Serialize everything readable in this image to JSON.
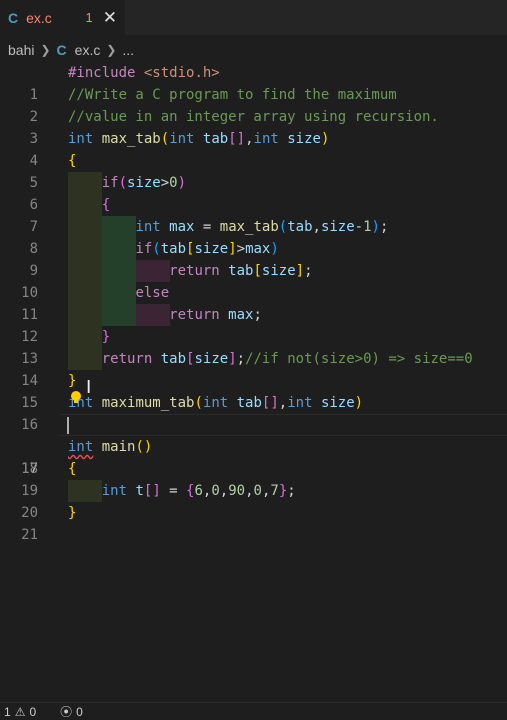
{
  "tab": {
    "icon": "C",
    "name": "ex.c",
    "problem_count": "1",
    "close_icon": "close-icon"
  },
  "breadcrumb": {
    "folder": "bahi",
    "icon": "C",
    "file": "ex.c",
    "more": "..."
  },
  "code": {
    "l1_include": "#include",
    "l1_header": "<stdio.h>",
    "l2": "//Write a C program to find the maximum",
    "l3": "//value in an integer array using recursion.",
    "l4_int": "int",
    "l4_fn": "max_tab",
    "l4_int2": "int",
    "l4_tab": "tab",
    "l4_int3": "int",
    "l4_size": "size",
    "l6_if": "if",
    "l6_size": "size",
    "l6_zero": "0",
    "l8_int": "int",
    "l8_max": "max",
    "l8_fn": "max_tab",
    "l8_tab": "tab",
    "l8_size": "size",
    "l8_one": "1",
    "l9_if": "if",
    "l9_tab": "tab",
    "l9_size": "size",
    "l9_max": "max",
    "l10_ret": "return",
    "l10_tab": "tab",
    "l10_size": "size",
    "l11_else": "else",
    "l12_ret": "return",
    "l12_max": "max",
    "l14_ret": "return",
    "l14_tab": "tab",
    "l14_size": "size",
    "l14_cm": "//if not(size>0) => size==0",
    "l16_int": "int",
    "l16_fn": "maximum_tab",
    "l16_int2": "int",
    "l16_tab": "tab",
    "l16_int3": "int",
    "l16_size": "size",
    "l18_int": "int",
    "l18_fn": "main",
    "l20_int": "int",
    "l20_t": "t",
    "l20_n1": "6",
    "l20_n2": "0",
    "l20_n3": "90",
    "l20_n4": "0",
    "l20_n5": "7"
  },
  "line_numbers": [
    "1",
    "2",
    "3",
    "4",
    "5",
    "6",
    "7",
    "8",
    "9",
    "10",
    "11",
    "12",
    "13",
    "14",
    "15",
    "16",
    "17",
    "18",
    "19",
    "20",
    "21"
  ],
  "active_line": "17",
  "status": {
    "errors": "1",
    "warnings": "0",
    "ports": "0"
  }
}
